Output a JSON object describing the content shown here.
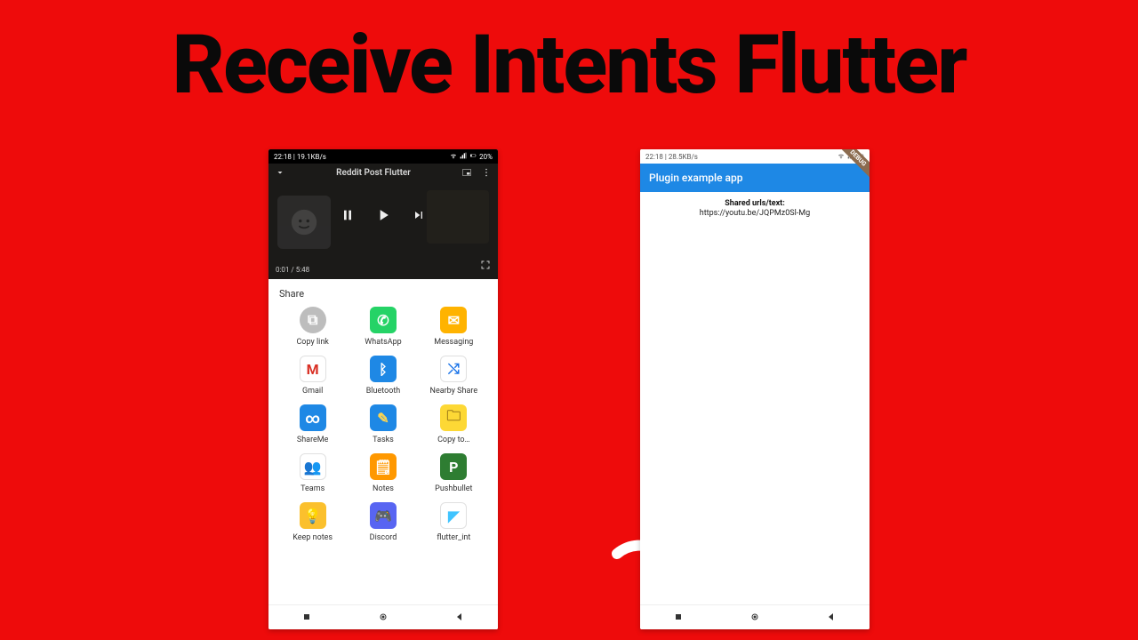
{
  "title": "Receive Intents Flutter",
  "left_phone": {
    "status_left": "22:18 | 19.1KB/s",
    "status_battery": "20%",
    "video": {
      "title": "Reddit Post Flutter",
      "time": "0:01 / 5:48"
    },
    "share_label": "Share",
    "share_items": [
      {
        "name": "copy-link",
        "label": "Copy link",
        "bg": "#bdbdbd",
        "fg": "#fff",
        "glyph": "⧉"
      },
      {
        "name": "whatsapp",
        "label": "WhatsApp",
        "bg": "#25d366",
        "fg": "#fff",
        "glyph": "✆"
      },
      {
        "name": "messaging",
        "label": "Messaging",
        "bg": "#ffb300",
        "fg": "#fff",
        "glyph": "✉"
      },
      {
        "name": "gmail",
        "label": "Gmail",
        "bg": "#ffffff",
        "fg": "#d93025",
        "glyph": "M"
      },
      {
        "name": "bluetooth",
        "label": "Bluetooth",
        "bg": "#1e88e5",
        "fg": "#fff",
        "glyph": "ᛒ"
      },
      {
        "name": "nearby-share",
        "label": "Nearby Share",
        "bg": "#ffffff",
        "fg": "#1a73e8",
        "glyph": "⤭"
      },
      {
        "name": "shareme",
        "label": "ShareMe",
        "bg": "#1e88e5",
        "fg": "#fff",
        "glyph": "∞"
      },
      {
        "name": "tasks",
        "label": "Tasks",
        "bg": "#1e88e5",
        "fg": "#ffd54f",
        "glyph": "✎"
      },
      {
        "name": "copy-to",
        "label": "Copy to…",
        "bg": "#fdd835",
        "fg": "#a07d1a",
        "glyph": "🗀"
      },
      {
        "name": "teams",
        "label": "Teams",
        "bg": "#ffffff",
        "fg": "#4b53bc",
        "glyph": "👥"
      },
      {
        "name": "notes",
        "label": "Notes",
        "bg": "#ff9800",
        "fg": "#fff",
        "glyph": "🗒"
      },
      {
        "name": "pushbullet",
        "label": "Pushbullet",
        "bg": "#2e7d32",
        "fg": "#fff",
        "glyph": "P"
      },
      {
        "name": "keep-notes",
        "label": "Keep notes",
        "bg": "#fbc02d",
        "fg": "#fff",
        "glyph": "💡"
      },
      {
        "name": "discord",
        "label": "Discord",
        "bg": "#5865f2",
        "fg": "#fff",
        "glyph": "🎮"
      },
      {
        "name": "flutter-int",
        "label": "flutter_int",
        "bg": "#ffffff",
        "fg": "#40c4ff",
        "glyph": "◤"
      }
    ]
  },
  "right_phone": {
    "status_left": "22:18 | 28.5KB/s",
    "debug": "DEBUG",
    "appbar_title": "Plugin example app",
    "shared_label": "Shared urls/text:",
    "shared_url": "https://youtu.be/JQPMz0Sl-Mg"
  }
}
